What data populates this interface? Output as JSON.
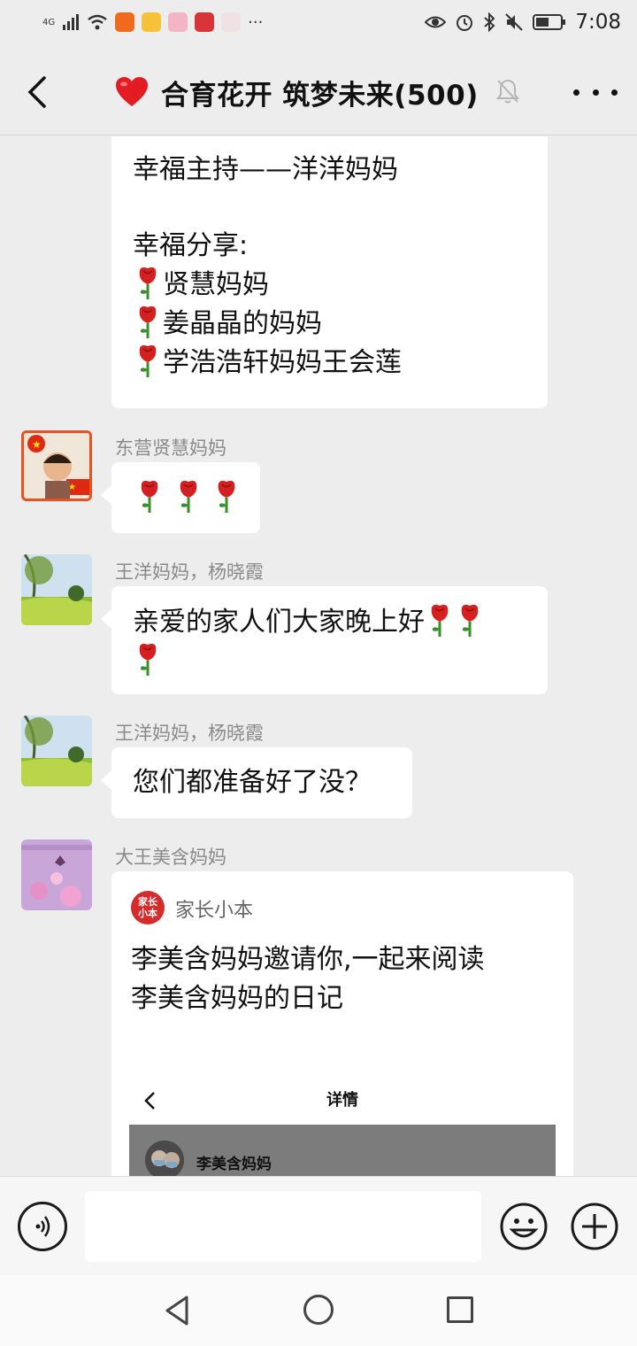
{
  "status": {
    "network": "4G",
    "time": "7:08",
    "battery": "battery-icon"
  },
  "header": {
    "title": "合育花开 筑梦未来(500)",
    "heart": "❤️"
  },
  "messages": {
    "m1": {
      "line1": "幸福主持——洋洋妈妈",
      "line2": "幸福分享:",
      "line3": "贤慧妈妈",
      "line4": "姜晶晶的妈妈",
      "line5": "学浩浩轩妈妈王会莲"
    },
    "m2": {
      "sender": "东营贤慧妈妈"
    },
    "m3": {
      "sender": "王洋妈妈，杨晓霞",
      "text": "亲爱的家人们大家晚上好"
    },
    "m4": {
      "sender": "王洋妈妈，杨晓霞",
      "text": "您们都准备好了没？"
    },
    "m5": {
      "sender": "大王美含妈妈",
      "card_source": "家长小本",
      "card_logo_line1": "家长",
      "card_logo_line2": "小本",
      "card_text_line1": "李美含妈妈邀请你,一起来阅读",
      "card_text_line2": "李美含妈妈的日记",
      "preview_title": "详情",
      "preview_name": "李美含妈妈"
    }
  },
  "input": {
    "placeholder": ""
  },
  "colors": {
    "rose": "#d42020",
    "stem": "#3a8f2a",
    "logo": "#d62b2b"
  }
}
